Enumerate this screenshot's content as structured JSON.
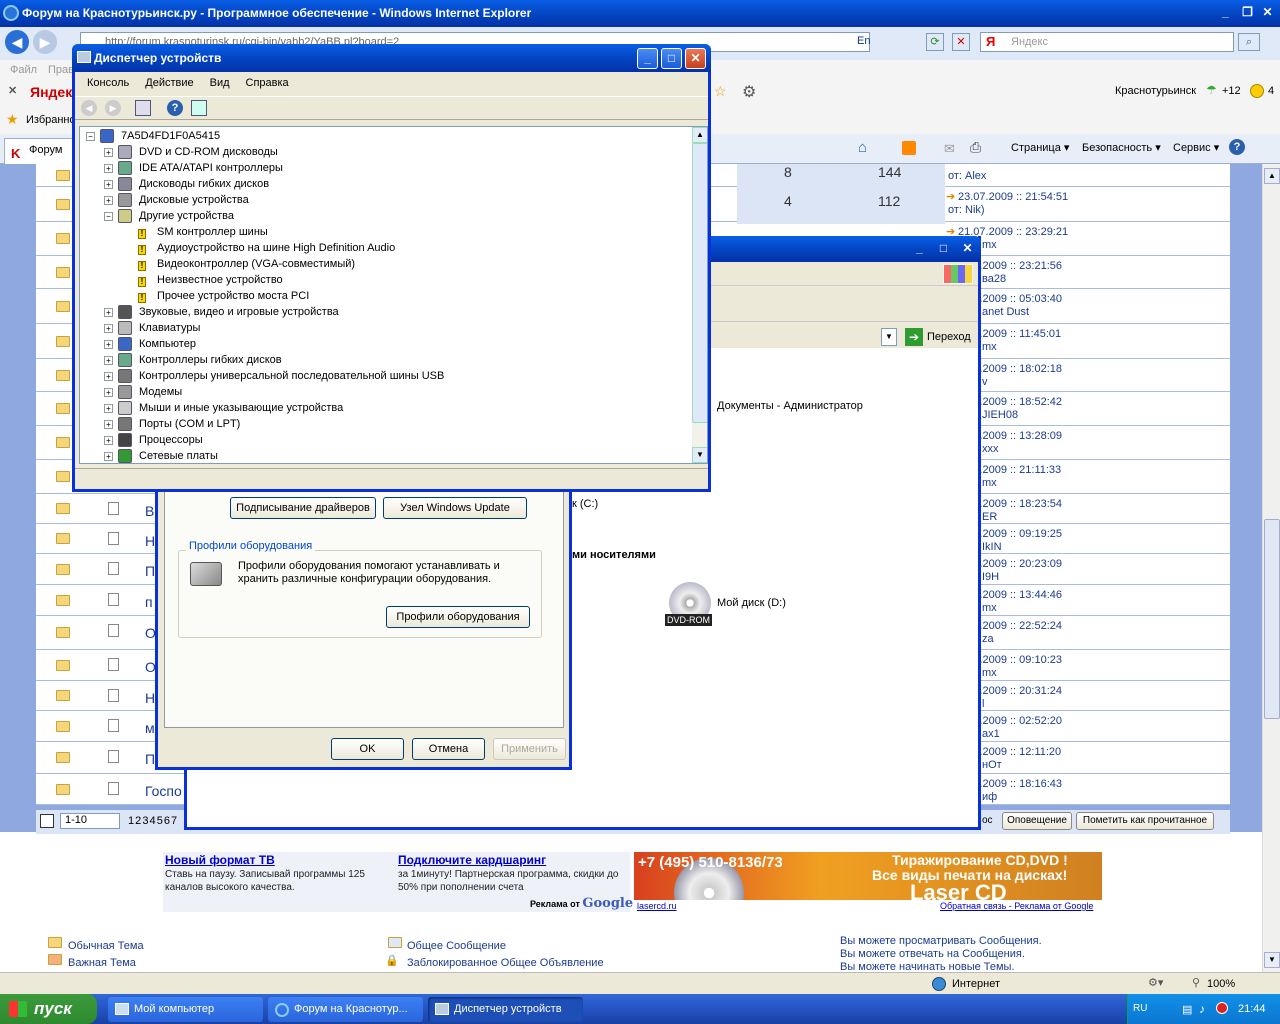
{
  "ie": {
    "title": "Форум на Краснотурьинск.ру - Программное обеспечение - Windows Internet Explorer",
    "address": "http://forum.krasnoturinsk.ru/cgi-bin/yabb2/YaBB.pl?board=2",
    "search_placeholder": "Яндекс",
    "lang": "En",
    "menu": [
      "Файл",
      "Правка"
    ],
    "yandex": "Яндекс",
    "city": "Краснотурьинск",
    "temp": "+12",
    "count": "4",
    "fav": "Избранное",
    "tab": "Форум на",
    "cmd": {
      "page": "Страница",
      "security": "Безопасность",
      "service": "Сервис"
    },
    "zone": "Интернет",
    "zoom": "100%"
  },
  "devmgr": {
    "title": "Диспетчер устройств",
    "menu": [
      "Консоль",
      "Действие",
      "Вид",
      "Справка"
    ],
    "tree": [
      {
        "label": "7A5D4FD1F0A5415",
        "level": 0,
        "pm": "−",
        "kind": "pc"
      },
      {
        "label": "DVD и CD-ROM дисководы",
        "level": 1,
        "pm": "+",
        "kind": "cd"
      },
      {
        "label": "IDE ATA/ATAPI контроллеры",
        "level": 1,
        "pm": "+",
        "kind": "ide"
      },
      {
        "label": "Дисководы гибких дисков",
        "level": 1,
        "pm": "+",
        "kind": "fdd"
      },
      {
        "label": "Дисковые устройства",
        "level": 1,
        "pm": "+",
        "kind": "hdd"
      },
      {
        "label": "Другие устройства",
        "level": 1,
        "pm": "−",
        "kind": "other"
      },
      {
        "label": "SM контроллер шины",
        "level": 2,
        "pm": "",
        "kind": "warn"
      },
      {
        "label": "Аудиоустройство на шине High Definition Audio",
        "level": 2,
        "pm": "",
        "kind": "warn"
      },
      {
        "label": "Видеоконтроллер (VGA-совместимый)",
        "level": 2,
        "pm": "",
        "kind": "warn"
      },
      {
        "label": "Неизвестное устройство",
        "level": 2,
        "pm": "",
        "kind": "warn"
      },
      {
        "label": "Прочее устройство моста PCI",
        "level": 2,
        "pm": "",
        "kind": "warn"
      },
      {
        "label": "Звуковые, видео и игровые устройства",
        "level": 1,
        "pm": "+",
        "kind": "sound"
      },
      {
        "label": "Клавиатуры",
        "level": 1,
        "pm": "+",
        "kind": "kbd"
      },
      {
        "label": "Компьютер",
        "level": 1,
        "pm": "+",
        "kind": "pc"
      },
      {
        "label": "Контроллеры гибких дисков",
        "level": 1,
        "pm": "+",
        "kind": "ide"
      },
      {
        "label": "Контроллеры универсальной последовательной шины USB",
        "level": 1,
        "pm": "+",
        "kind": "usb"
      },
      {
        "label": "Модемы",
        "level": 1,
        "pm": "+",
        "kind": "modem"
      },
      {
        "label": "Мыши и иные указывающие устройства",
        "level": 1,
        "pm": "+",
        "kind": "mouse"
      },
      {
        "label": "Порты (COM и LPT)",
        "level": 1,
        "pm": "+",
        "kind": "port"
      },
      {
        "label": "Процессоры",
        "level": 1,
        "pm": "+",
        "kind": "cpu"
      },
      {
        "label": "Сетевые платы",
        "level": 1,
        "pm": "+",
        "kind": "net"
      }
    ]
  },
  "sysprop": {
    "sign_btn": "Подписывание драйверов",
    "wu_btn": "Узел Windows Update",
    "hw_group": "Профили оборудования",
    "hw_text": "Профили оборудования помогают устанавливать и хранить различные конфигурации оборудования.",
    "hw_btn": "Профили оборудования",
    "ok": "OK",
    "cancel": "Отмена",
    "apply": "Применить"
  },
  "mycomp": {
    "go": "Переход",
    "docs": "Документы - Администратор",
    "disk_c": "к (C:)",
    "removable": "ми носителями",
    "dvd_name": "Мой диск (D:)",
    "dvd_label": "DVD-ROM"
  },
  "forum": {
    "stats": [
      {
        "a": "8",
        "b": "144"
      },
      {
        "a": "4",
        "b": "112"
      }
    ],
    "replies": [
      {
        "date": "",
        "by": "от: Alex"
      },
      {
        "date": "23.07.2009 :: 21:54:51",
        "by": "от: Nik)"
      },
      {
        "date": "21.07.2009 :: 23:29:21",
        "by": "mx"
      },
      {
        "date": "0.07.2009 :: 23:21:56",
        "by": "ва28"
      },
      {
        "date": "8.07.2009 :: 05:03:40",
        "by": "anet Dust"
      },
      {
        "date": "7.07.2009 :: 11:45:01",
        "by": "mx"
      },
      {
        "date": "5.07.2009 :: 18:02:18",
        "by": "v"
      },
      {
        "date": "4.07.2009 :: 18:52:42",
        "by": "JIEH08"
      },
      {
        "date": "4.07.2009 :: 13:28:09",
        "by": "xxx"
      },
      {
        "date": "5.07.2009 :: 21:11:33",
        "by": "mx"
      },
      {
        "date": "4.07.2009 :: 18:23:54",
        "by": "ER"
      },
      {
        "date": "8.07.2009 :: 09:19:25",
        "by": "IkIN"
      },
      {
        "date": "8.06.2009 :: 20:23:09",
        "by": "I9H"
      },
      {
        "date": "7.06.2009 :: 13:44:46",
        "by": "mx"
      },
      {
        "date": "4.06.2009 :: 22:52:24",
        "by": "za"
      },
      {
        "date": "2.06.2009 :: 09:10:23",
        "by": "mx"
      },
      {
        "date": "8.06.2009 :: 20:31:24",
        "by": "l"
      },
      {
        "date": "8.06.2009 :: 02:52:20",
        "by": "ax1"
      },
      {
        "date": "6.06.2009 :: 12:11:20",
        "by": "нОт"
      },
      {
        "date": "8.06.2009 :: 18:16:43",
        "by": "иф"
      }
    ],
    "subjects": [
      "В",
      "Н",
      "П",
      "п",
      "О",
      "О",
      "Н",
      "м",
      "П",
      "Госпо"
    ],
    "pager_select": "1-10",
    "pages": "1 2 3 4 5 6 7",
    "notify": "Оповещение",
    "mark_read": "Пометить как прочитанное",
    "oc": "ос",
    "ad1_title": "Новый формат ТВ",
    "ad1_text": "Ставь на паузу. Записывай программы 125 каналов высокого качества.",
    "ad2_title": "Подключите кардшаринг",
    "ad2_text": "за 1минуту! Партнерская программа, скидки до 50% при пополнении счета",
    "ad_by": "Реклама от",
    "google": "Google",
    "banner_phone": "+7 (495) 510-8136/73",
    "banner_t1": "Тиражирование CD,DVD !",
    "banner_t2": "Все виды печати на дисках!",
    "banner_brand": "Laser CD",
    "banner_site": "lasercd.ru",
    "feedback": "Обратная связь - Реклама от Google",
    "legend": [
      "Обычная Тема",
      "Важная Тема",
      "Общее Сообщение",
      "Заблокированное Общее Объявление"
    ],
    "perm": [
      "Вы можете просматривать Сообщения.",
      "Вы можете отвечать на Сообщения.",
      "Вы можете начинать новые Темы."
    ]
  },
  "taskbar": {
    "start": "пуск",
    "items": [
      "Мой компьютер",
      "Форум на Краснотур...",
      "Диспетчер устройств"
    ],
    "lang": "RU",
    "clock": "21:44"
  }
}
